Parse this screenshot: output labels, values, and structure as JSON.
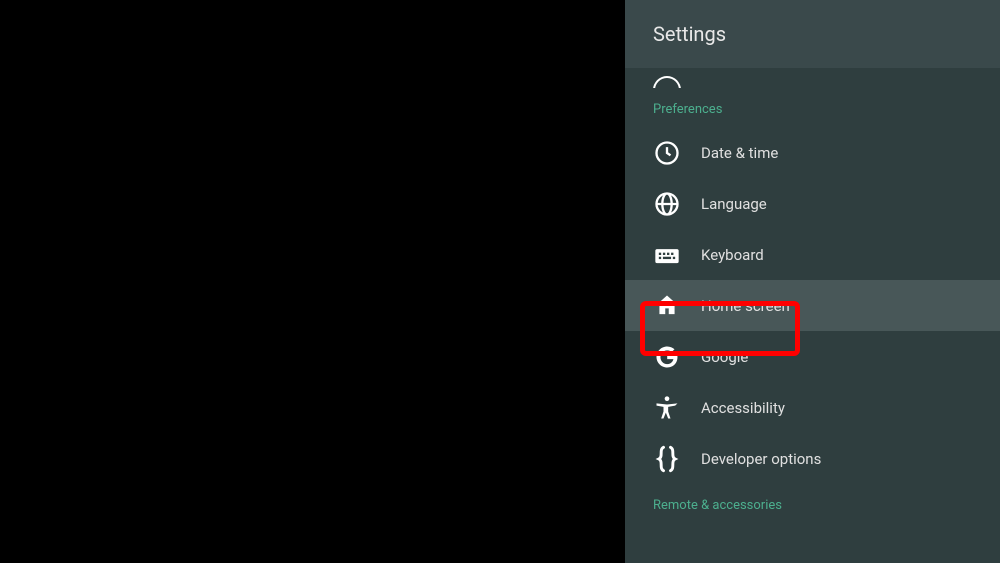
{
  "header": {
    "title": "Settings"
  },
  "sections": {
    "preferences": {
      "title": "Preferences",
      "items": [
        {
          "label": "Date & time"
        },
        {
          "label": "Language"
        },
        {
          "label": "Keyboard"
        },
        {
          "label": "Home screen"
        },
        {
          "label": "Google"
        },
        {
          "label": "Accessibility"
        },
        {
          "label": "Developer options"
        }
      ]
    },
    "remote": {
      "title": "Remote & accessories"
    }
  },
  "highlighted_index": 3
}
